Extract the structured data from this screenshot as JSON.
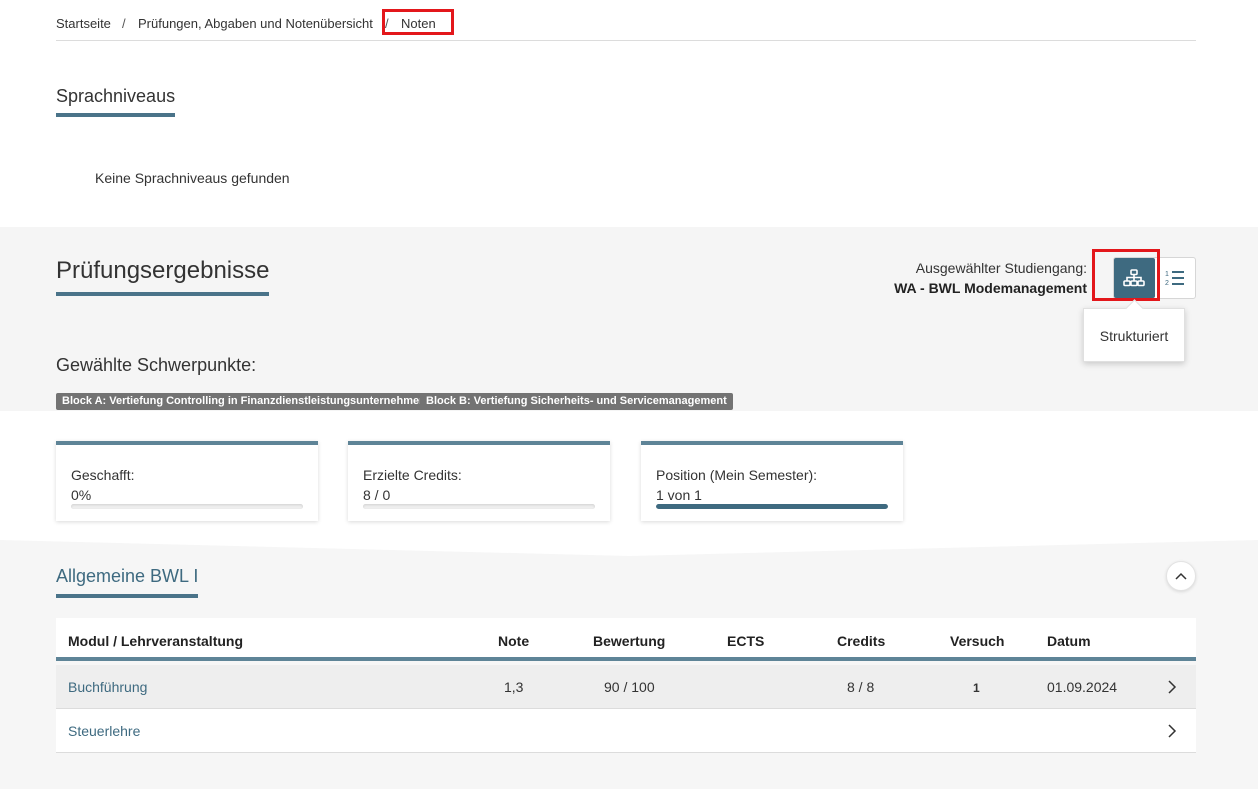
{
  "breadcrumb": {
    "home": "Startseite",
    "sep1": "/",
    "parent": "Prüfungen, Abgaben und Notenübersicht",
    "sep2": "/",
    "current": "Noten"
  },
  "language": {
    "title": "Sprachniveaus",
    "empty_text": "Keine Sprachniveaus gefunden"
  },
  "results": {
    "title": "Prüfungsergebnisse",
    "program_label": "Ausgewählter Studiengang:",
    "program_value": "WA - BWL Modemanagement",
    "view_toggle": {
      "structured_icon": "sitemap-icon",
      "list_icon": "numbered-list-icon",
      "tooltip": "Strukturiert",
      "active": "structured"
    },
    "focus_title": "Gewählte Schwerpunkte:",
    "focus_badges": [
      "Block A: Vertiefung Controlling in Finanzdienstleistungsunternehmen",
      "Block B: Vertiefung Sicherheits- und Servicemanagement"
    ]
  },
  "stats": [
    {
      "label": "Geschafft:",
      "value": "0%",
      "progress": 0
    },
    {
      "label": "Erzielte Credits:",
      "value": "8 / 0",
      "progress": 0
    },
    {
      "label": "Position (Mein Semester):",
      "value": "1 von 1",
      "progress": 1
    }
  ],
  "module_group": {
    "title": "Allgemeine BWL I",
    "collapse_icon": "chevron-up-icon",
    "columns": [
      "Modul / Lehrveranstaltung",
      "Note",
      "Bewertung",
      "ECTS",
      "Credits",
      "Versuch",
      "Datum"
    ],
    "rows": [
      {
        "name": "Buchführung",
        "note": "1,3",
        "bewertung": "90 / 100",
        "ects": "",
        "credits": "8 / 8",
        "versuch": "1",
        "datum": "01.09.2024"
      },
      {
        "name": "Steuerlehre",
        "note": "",
        "bewertung": "",
        "ects": "",
        "credits": "",
        "versuch": "",
        "datum": ""
      }
    ]
  },
  "colors": {
    "accent": "#3e6a80",
    "highlight": "#e3171b",
    "badge": "#737373"
  }
}
